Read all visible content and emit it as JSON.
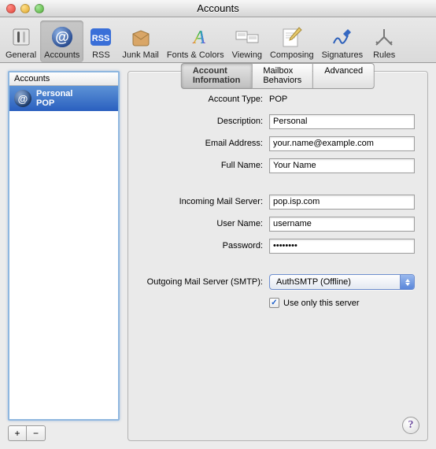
{
  "window": {
    "title": "Accounts"
  },
  "toolbar": {
    "items": [
      {
        "label": "General"
      },
      {
        "label": "Accounts"
      },
      {
        "label": "RSS"
      },
      {
        "label": "Junk Mail"
      },
      {
        "label": "Fonts & Colors"
      },
      {
        "label": "Viewing"
      },
      {
        "label": "Composing"
      },
      {
        "label": "Signatures"
      },
      {
        "label": "Rules"
      }
    ]
  },
  "sidebar": {
    "header": "Accounts",
    "rows": [
      {
        "glyph": "@",
        "name": "Personal",
        "type": "POP"
      }
    ],
    "add_label": "+",
    "remove_label": "−"
  },
  "tabs": [
    {
      "label": "Account Information"
    },
    {
      "label": "Mailbox Behaviors"
    },
    {
      "label": "Advanced"
    }
  ],
  "form": {
    "account_type_label": "Account Type:",
    "account_type_value": "POP",
    "description_label": "Description:",
    "description_value": "Personal",
    "email_label": "Email Address:",
    "email_value": "your.name@example.com",
    "fullname_label": "Full Name:",
    "fullname_value": "Your Name",
    "incoming_label": "Incoming Mail Server:",
    "incoming_value": "pop.isp.com",
    "username_label": "User Name:",
    "username_value": "username",
    "password_label": "Password:",
    "password_value": "••••••••",
    "smtp_label": "Outgoing Mail Server (SMTP):",
    "smtp_value": "AuthSMTP (Offline)",
    "use_only_label": "Use only this server",
    "use_only_checked": true
  },
  "help_glyph": "?"
}
